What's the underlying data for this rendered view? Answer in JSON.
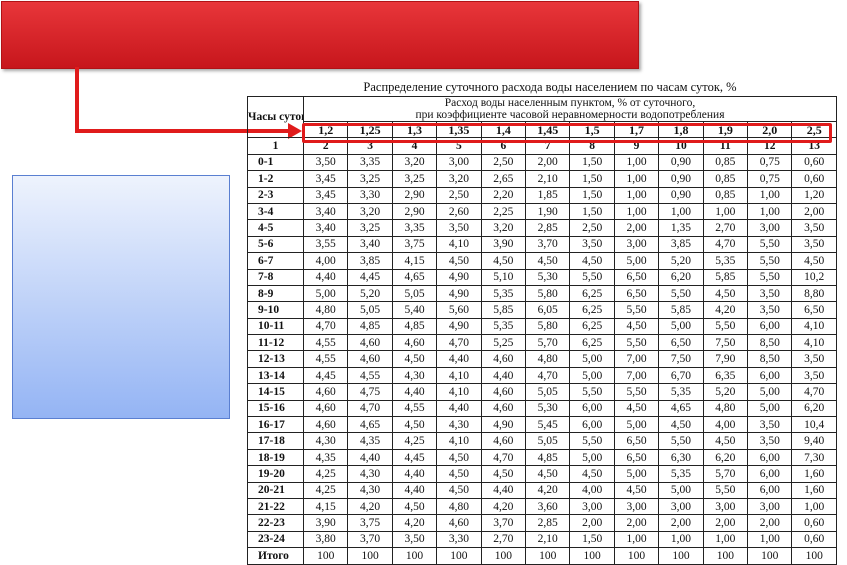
{
  "table": {
    "title": "Распределение суточного расхода воды населением по часам суток, %",
    "hours_header": "Часы суток",
    "main_header_line1": "Расход воды населенным пунктом, % от суточного,",
    "main_header_line2": "при коэффициенте часовой неравномерности водопотребления",
    "coefficients": [
      "1,2",
      "1,25",
      "1,3",
      "1,35",
      "1,4",
      "1,45",
      "1,5",
      "1,7",
      "1,8",
      "1,9",
      "2,0",
      "2,5"
    ],
    "column_numbers": [
      "1",
      "2",
      "3",
      "4",
      "5",
      "6",
      "7",
      "8",
      "9",
      "10",
      "11",
      "12",
      "13"
    ],
    "rows": [
      {
        "hour": "0-1",
        "values": [
          "3,50",
          "3,35",
          "3,20",
          "3,00",
          "2,50",
          "2,00",
          "1,50",
          "1,00",
          "0,90",
          "0,85",
          "0,75",
          "0,60"
        ]
      },
      {
        "hour": "1-2",
        "values": [
          "3,45",
          "3,25",
          "3,25",
          "3,20",
          "2,65",
          "2,10",
          "1,50",
          "1,00",
          "0,90",
          "0,85",
          "0,75",
          "0,60"
        ]
      },
      {
        "hour": "2-3",
        "values": [
          "3,45",
          "3,30",
          "2,90",
          "2,50",
          "2,20",
          "1,85",
          "1,50",
          "1,00",
          "0,90",
          "0,85",
          "1,00",
          "1,20"
        ]
      },
      {
        "hour": "3-4",
        "values": [
          "3,40",
          "3,20",
          "2,90",
          "2,60",
          "2,25",
          "1,90",
          "1,50",
          "1,00",
          "1,00",
          "1,00",
          "1,00",
          "2,00"
        ]
      },
      {
        "hour": "4-5",
        "values": [
          "3,40",
          "3,25",
          "3,35",
          "3,50",
          "3,20",
          "2,85",
          "2,50",
          "2,00",
          "1,35",
          "2,70",
          "3,00",
          "3,50"
        ]
      },
      {
        "hour": "5-6",
        "values": [
          "3,55",
          "3,40",
          "3,75",
          "4,10",
          "3,90",
          "3,70",
          "3,50",
          "3,00",
          "3,85",
          "4,70",
          "5,50",
          "3,50"
        ]
      },
      {
        "hour": "6-7",
        "values": [
          "4,00",
          "3,85",
          "4,15",
          "4,50",
          "4,50",
          "4,50",
          "4,50",
          "5,00",
          "5,20",
          "5,35",
          "5,50",
          "4,50"
        ]
      },
      {
        "hour": "7-8",
        "values": [
          "4,40",
          "4,45",
          "4,65",
          "4,90",
          "5,10",
          "5,30",
          "5,50",
          "6,50",
          "6,20",
          "5,85",
          "5,50",
          "10,2"
        ]
      },
      {
        "hour": "8-9",
        "values": [
          "5,00",
          "5,20",
          "5,05",
          "4,90",
          "5,35",
          "5,80",
          "6,25",
          "6,50",
          "5,50",
          "4,50",
          "3,50",
          "8,80"
        ]
      },
      {
        "hour": "9-10",
        "values": [
          "4,80",
          "5,05",
          "5,40",
          "5,60",
          "5,85",
          "6,05",
          "6,25",
          "5,50",
          "5,85",
          "4,20",
          "3,50",
          "6,50"
        ]
      },
      {
        "hour": "10-11",
        "values": [
          "4,70",
          "4,85",
          "4,85",
          "4,90",
          "5,35",
          "5,80",
          "6,25",
          "4,50",
          "5,00",
          "5,50",
          "6,00",
          "4,10"
        ]
      },
      {
        "hour": "11-12",
        "values": [
          "4,55",
          "4,60",
          "4,60",
          "4,70",
          "5,25",
          "5,70",
          "6,25",
          "5,50",
          "6,50",
          "7,50",
          "8,50",
          "4,10"
        ]
      },
      {
        "hour": "12-13",
        "values": [
          "4,55",
          "4,60",
          "4,50",
          "4,40",
          "4,60",
          "4,80",
          "5,00",
          "7,00",
          "7,50",
          "7,90",
          "8,50",
          "3,50"
        ]
      },
      {
        "hour": "13-14",
        "values": [
          "4,45",
          "4,55",
          "4,30",
          "4,10",
          "4,40",
          "4,70",
          "5,00",
          "7,00",
          "6,70",
          "6,35",
          "6,00",
          "3,50"
        ]
      },
      {
        "hour": "14-15",
        "values": [
          "4,60",
          "4,75",
          "4,40",
          "4,10",
          "4,60",
          "5,05",
          "5,50",
          "5,50",
          "5,35",
          "5,20",
          "5,00",
          "4,70"
        ]
      },
      {
        "hour": "15-16",
        "values": [
          "4,60",
          "4,70",
          "4,55",
          "4,40",
          "4,60",
          "5,30",
          "6,00",
          "4,50",
          "4,65",
          "4,80",
          "5,00",
          "6,20"
        ]
      },
      {
        "hour": "16-17",
        "values": [
          "4,60",
          "4,65",
          "4,50",
          "4,30",
          "4,90",
          "5,45",
          "6,00",
          "5,00",
          "4,50",
          "4,00",
          "3,50",
          "10,4"
        ]
      },
      {
        "hour": "17-18",
        "values": [
          "4,30",
          "4,35",
          "4,25",
          "4,10",
          "4,60",
          "5,05",
          "5,50",
          "6,50",
          "5,50",
          "4,50",
          "3,50",
          "9,40"
        ]
      },
      {
        "hour": "18-19",
        "values": [
          "4,35",
          "4,40",
          "4,45",
          "4,50",
          "4,70",
          "4,85",
          "5,00",
          "6,50",
          "6,30",
          "6,20",
          "6,00",
          "7,30"
        ]
      },
      {
        "hour": "19-20",
        "values": [
          "4,25",
          "4,30",
          "4,40",
          "4,50",
          "4,50",
          "4,50",
          "4,50",
          "5,00",
          "5,35",
          "5,70",
          "6,00",
          "1,60"
        ]
      },
      {
        "hour": "20-21",
        "values": [
          "4,25",
          "4,30",
          "4,40",
          "4,50",
          "4,40",
          "4,20",
          "4,00",
          "4,50",
          "5,00",
          "5,50",
          "6,00",
          "1,60"
        ]
      },
      {
        "hour": "21-22",
        "values": [
          "4,15",
          "4,20",
          "4,50",
          "4,80",
          "4,20",
          "3,60",
          "3,00",
          "3,00",
          "3,00",
          "3,00",
          "3,00",
          "1,00"
        ]
      },
      {
        "hour": "22-23",
        "values": [
          "3,90",
          "3,75",
          "4,20",
          "4,60",
          "3,70",
          "2,85",
          "2,00",
          "2,00",
          "2,00",
          "2,00",
          "2,00",
          "0,60"
        ]
      },
      {
        "hour": "23-24",
        "values": [
          "3,80",
          "3,70",
          "3,50",
          "3,30",
          "2,70",
          "2,10",
          "1,50",
          "1,00",
          "1,00",
          "1,00",
          "1,00",
          "0,60"
        ]
      },
      {
        "hour": "Итого",
        "values": [
          "100",
          "100",
          "100",
          "100",
          "100",
          "100",
          "100",
          "100",
          "100",
          "100",
          "100",
          "100"
        ]
      }
    ]
  },
  "colors": {
    "banner_red": "#d9272c",
    "arrow_red": "#e01b1b",
    "highlight_frame": "#e01b1b",
    "box_blue_top": "#eef3fd",
    "box_blue_bottom": "#94b4f4"
  }
}
